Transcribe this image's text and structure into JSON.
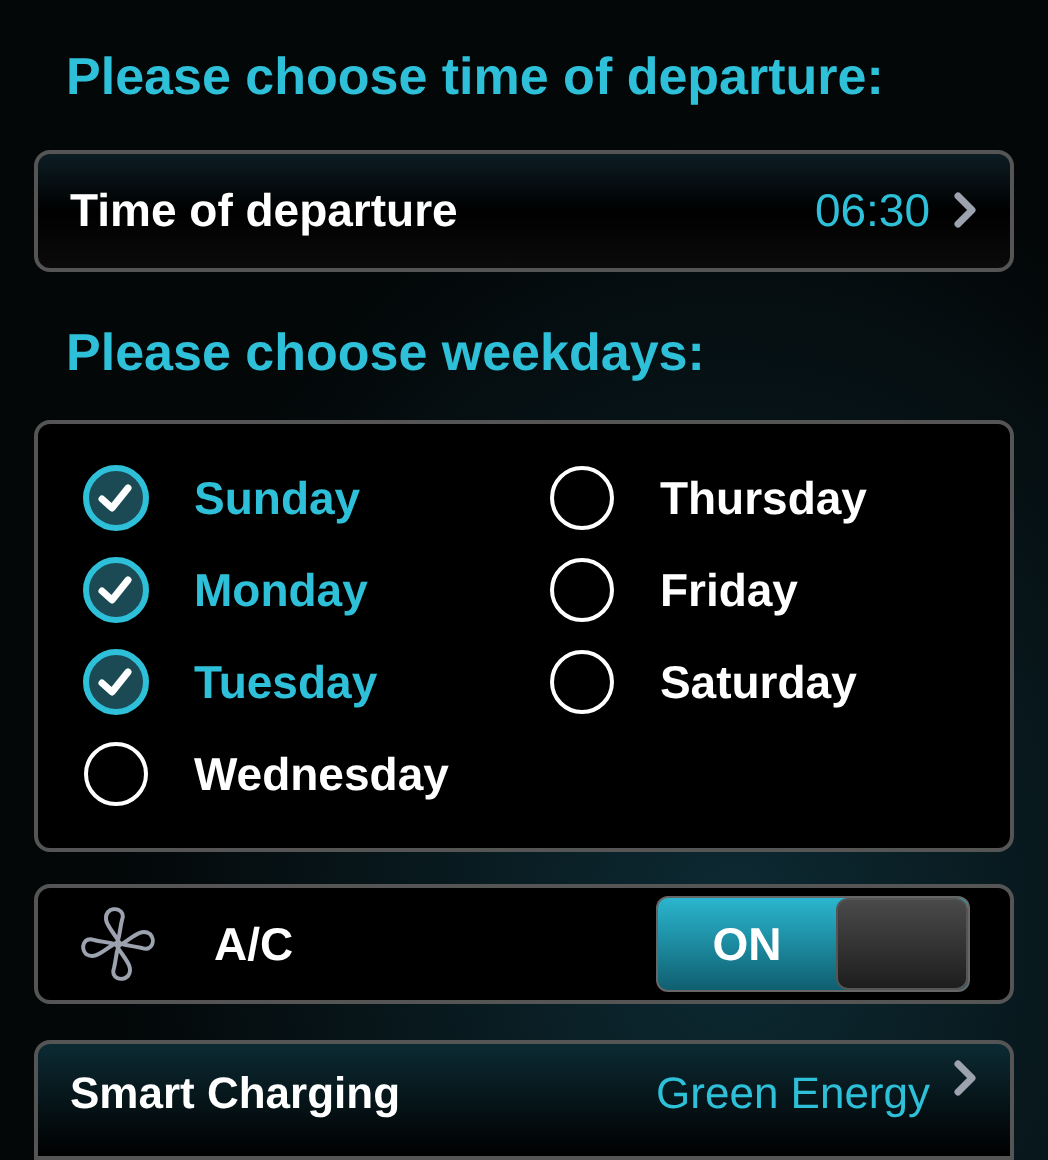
{
  "departure_heading": "Please choose time of departure:",
  "departure": {
    "label": "Time of departure",
    "value": "06:30"
  },
  "weekdays_heading": "Please choose weekdays:",
  "weekdays": [
    {
      "label": "Sunday",
      "checked": true
    },
    {
      "label": "Monday",
      "checked": true
    },
    {
      "label": "Tuesday",
      "checked": true
    },
    {
      "label": "Wednesday",
      "checked": false
    },
    {
      "label": "Thursday",
      "checked": false
    },
    {
      "label": "Friday",
      "checked": false
    },
    {
      "label": "Saturday",
      "checked": false
    }
  ],
  "ac": {
    "label": "A/C",
    "on": true,
    "switch_text": "ON"
  },
  "smart_charging": {
    "label": "Smart Charging",
    "value": "Green Energy"
  }
}
